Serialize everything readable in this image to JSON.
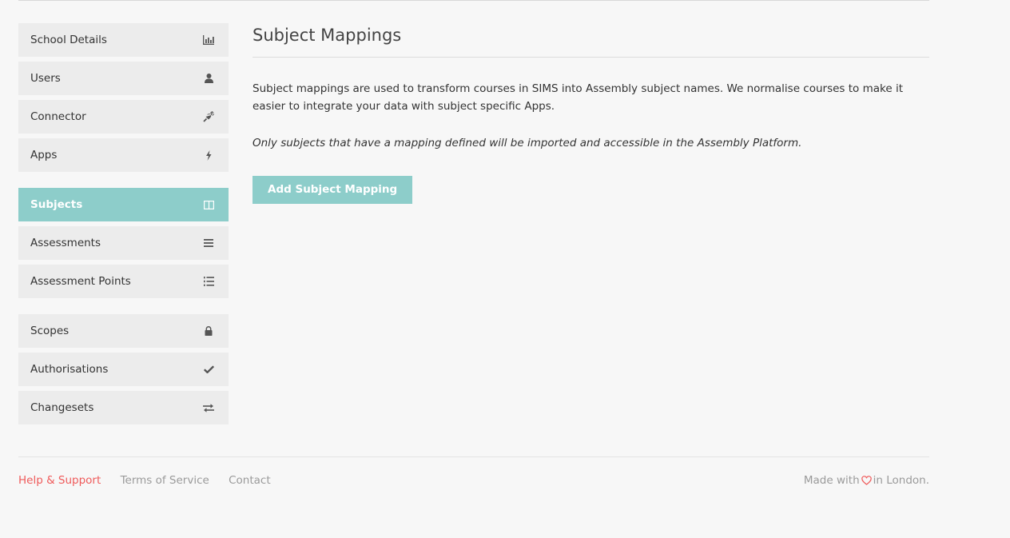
{
  "sidebar": {
    "groups": [
      {
        "items": [
          {
            "label": "School Details",
            "icon": "bar-chart-icon"
          },
          {
            "label": "Users",
            "icon": "user-icon"
          },
          {
            "label": "Connector",
            "icon": "plug-icon"
          },
          {
            "label": "Apps",
            "icon": "bolt-icon"
          }
        ]
      },
      {
        "items": [
          {
            "label": "Subjects",
            "icon": "columns-icon",
            "active": true
          },
          {
            "label": "Assessments",
            "icon": "list-icon"
          },
          {
            "label": "Assessment Points",
            "icon": "list-numbered-icon"
          }
        ]
      },
      {
        "items": [
          {
            "label": "Scopes",
            "icon": "lock-icon"
          },
          {
            "label": "Authorisations",
            "icon": "check-icon"
          },
          {
            "label": "Changesets",
            "icon": "exchange-icon"
          }
        ]
      }
    ]
  },
  "main": {
    "title": "Subject Mappings",
    "description": "Subject mappings are used to transform courses in SIMS into Assembly subject names. We normalise courses to make it easier to integrate your data with subject specific Apps.",
    "note": "Only subjects that have a mapping defined will be imported and accessible in the Assembly Platform.",
    "add_button_label": "Add Subject Mapping"
  },
  "footer": {
    "links": [
      "Help & Support",
      "Terms of Service",
      "Contact"
    ],
    "made_with": "Made with",
    "in_london": "in London."
  },
  "colors": {
    "accent": "#8dcdca",
    "help_link": "#ef5a5a",
    "heart": "#ef5a5a"
  }
}
